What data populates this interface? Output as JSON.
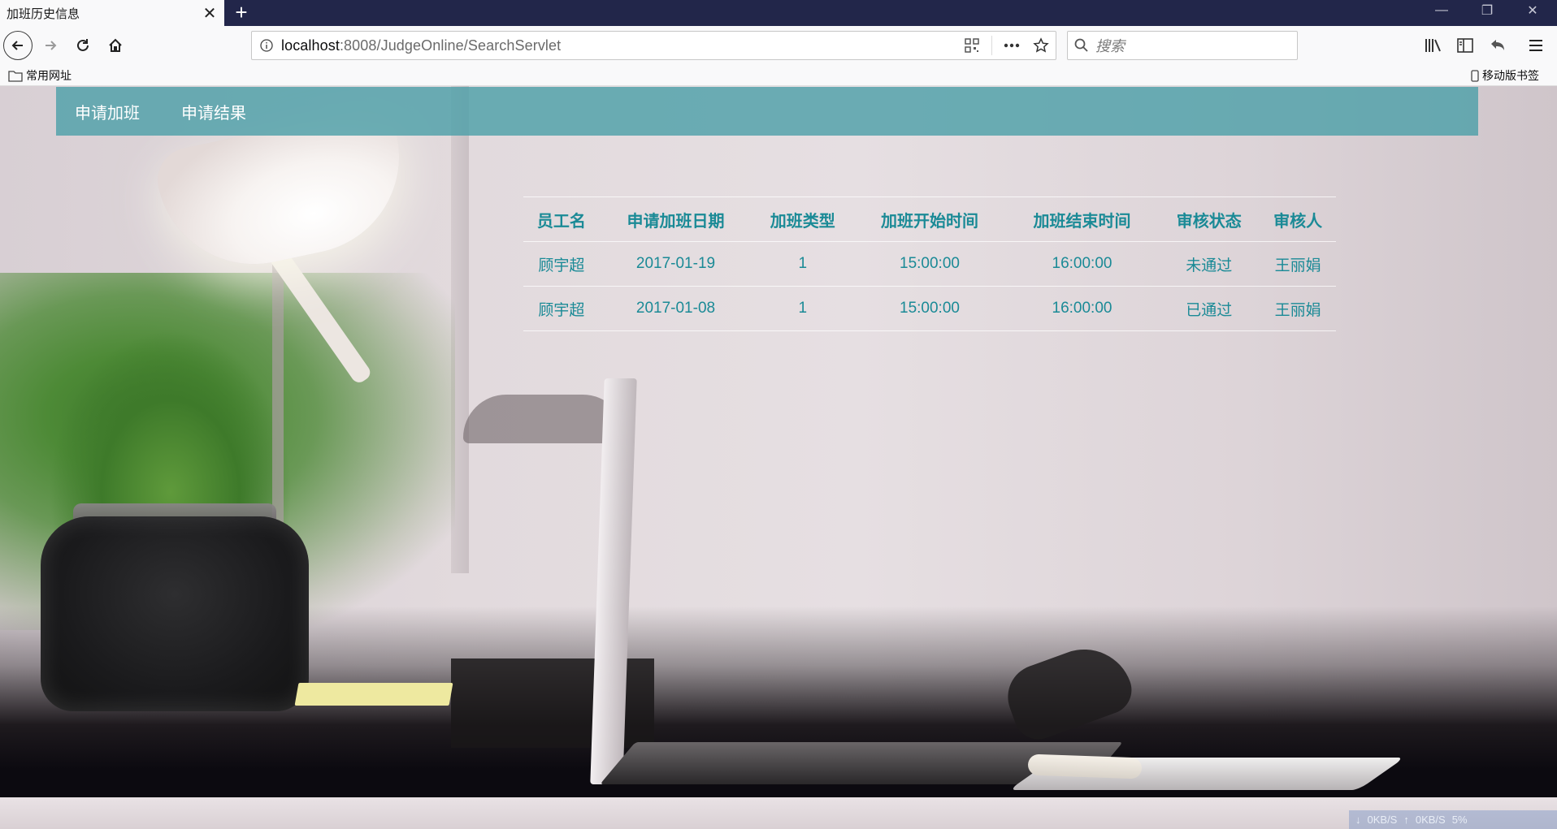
{
  "browser": {
    "tab_title": "加班历史信息",
    "tab_close_symbol": "✕",
    "new_tab_symbol": "+",
    "window_min_symbol": "—",
    "window_max_symbol": "❐",
    "window_close_symbol": "✕",
    "url_host": "localhost",
    "url_rest": ":8008/JudgeOnline/SearchServlet",
    "search_placeholder": "搜索",
    "bookmarks_left": "常用网址",
    "bookmarks_right": "移动版书签"
  },
  "site_nav": {
    "items": [
      {
        "label": "申请加班"
      },
      {
        "label": "申请结果"
      }
    ]
  },
  "table": {
    "headers": [
      "员工名",
      "申请加班日期",
      "加班类型",
      "加班开始时间",
      "加班结束时间",
      "审核状态",
      "审核人"
    ],
    "rows": [
      [
        "顾宇超",
        "2017-01-19",
        "1",
        "15:00:00",
        "16:00:00",
        "未通过",
        "王丽娟"
      ],
      [
        "顾宇超",
        "2017-01-08",
        "1",
        "15:00:00",
        "16:00:00",
        "已通过",
        "王丽娟"
      ]
    ]
  },
  "net_widget": {
    "down": "0KB/S",
    "up": "0KB/S",
    "percent": "5%"
  },
  "colors": {
    "accent_teal": "#1a8a96",
    "nav_bg": "#4ea0a8",
    "tabbar_bg": "#22264a"
  }
}
